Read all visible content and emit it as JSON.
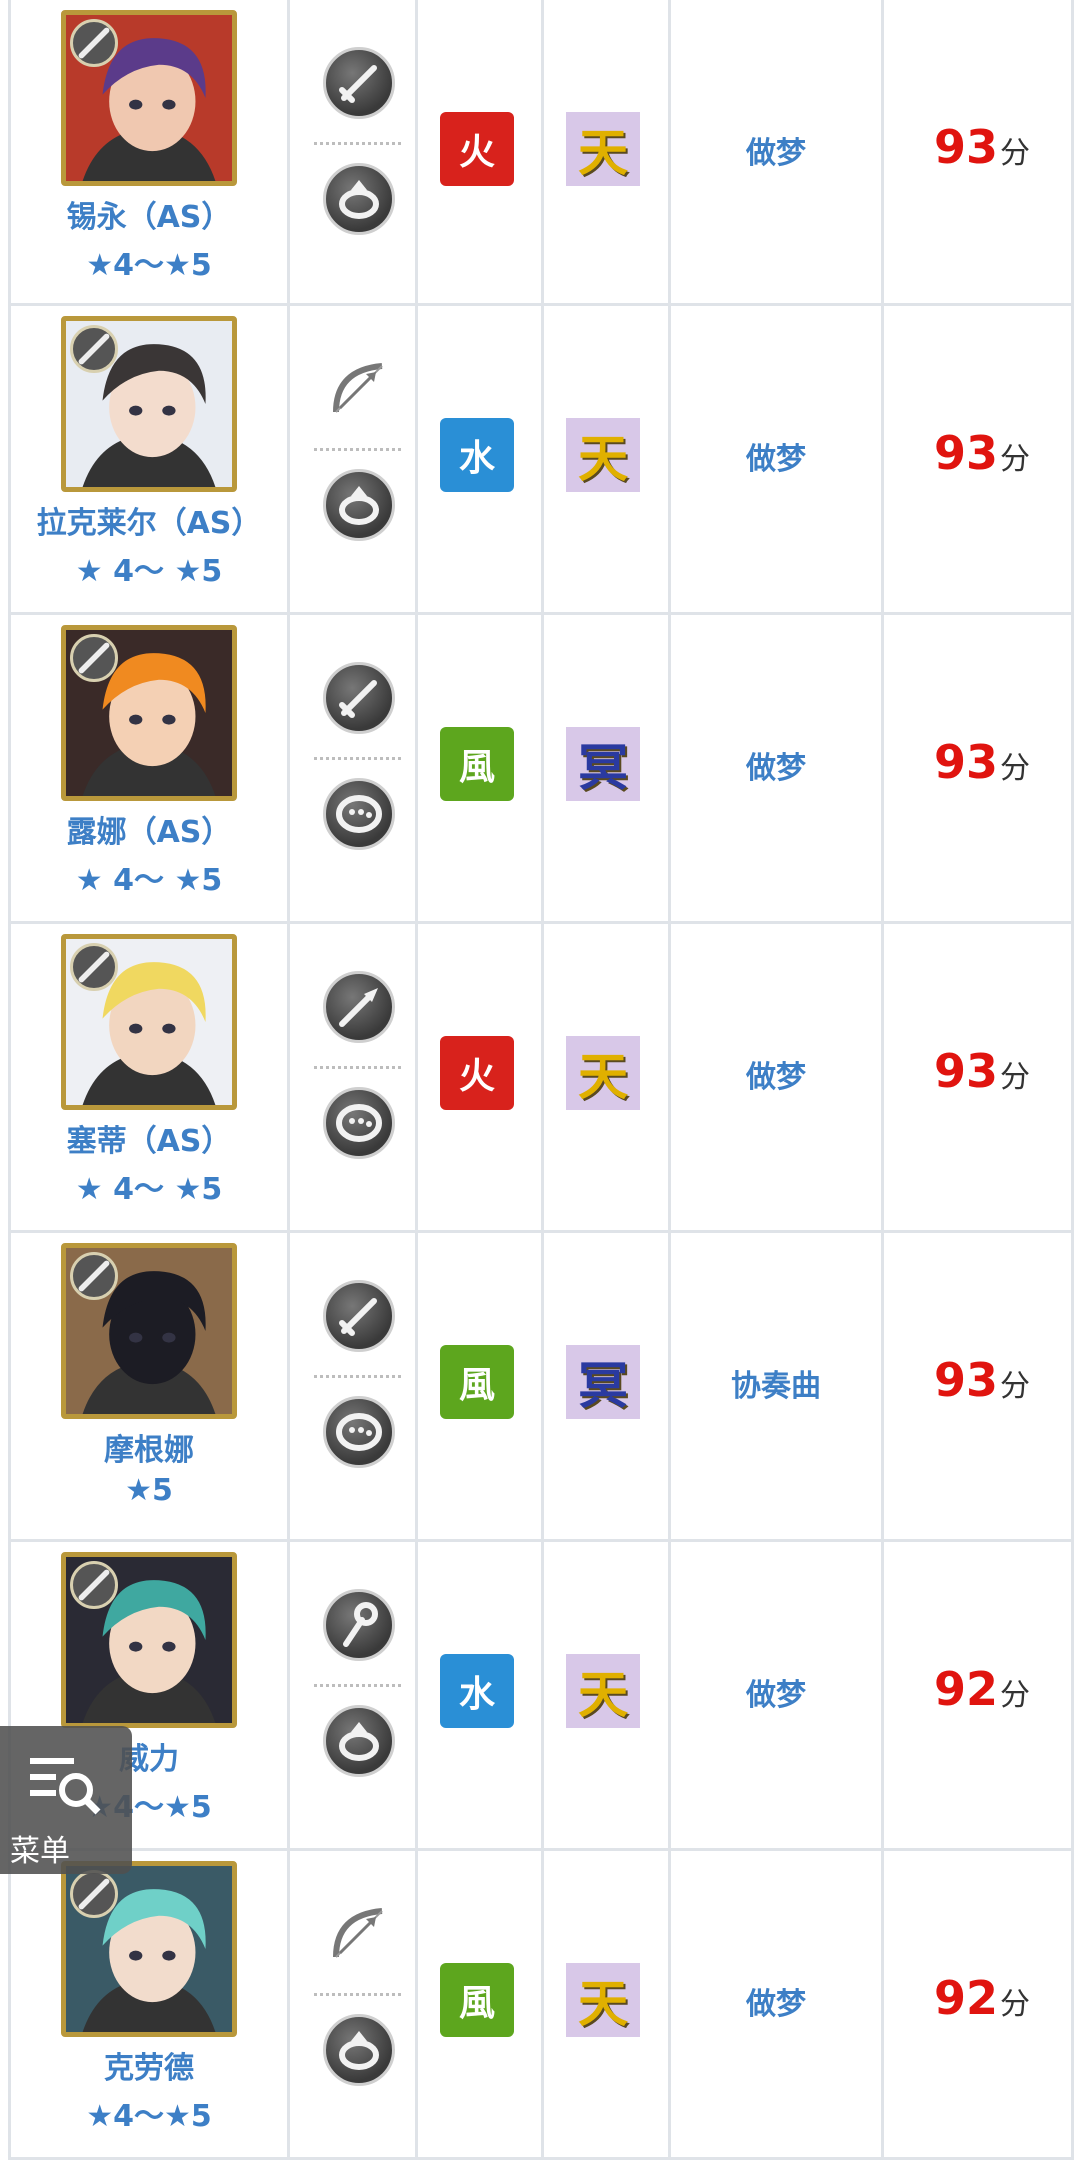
{
  "colors": {
    "fire": "#d8221c",
    "water": "#2a8fd6",
    "wind": "#5da61e",
    "name_blue": "#3d7fc6",
    "score_red": "#e0140f"
  },
  "rows": [
    {
      "name": "锡永（AS）",
      "stars": "★4～★5",
      "weapon_icon": "sword-icon",
      "accessory_icon": "ring-icon",
      "attr": "火",
      "attr_color": "#d8221c",
      "class": "天",
      "class_color": "#e0b000",
      "type": "做梦",
      "score": "93",
      "unit": "分",
      "skin": "#f0c8b0",
      "hair": "#5b3b8a",
      "bg": "#b83a2a"
    },
    {
      "name": "拉克莱尔（AS）",
      "stars": "★ 4～ ★5",
      "weapon_icon": "bow-icon",
      "accessory_icon": "ring-icon",
      "attr": "水",
      "attr_color": "#2a8fd6",
      "class": "天",
      "class_color": "#e0b000",
      "type": "做梦",
      "score": "93",
      "unit": "分",
      "skin": "#f3dccd",
      "hair": "#3a3636",
      "bg": "#e8ecf2"
    },
    {
      "name": "露娜（AS）",
      "stars": "★ 4～ ★5",
      "weapon_icon": "sword-icon",
      "accessory_icon": "bracelet-icon",
      "attr": "風",
      "attr_color": "#5da61e",
      "class": "冥",
      "class_color": "#2a3aa0",
      "type": "做梦",
      "score": "93",
      "unit": "分",
      "skin": "#f4d0b4",
      "hair": "#f08a20",
      "bg": "#3a2a28"
    },
    {
      "name": "塞蒂（AS）",
      "stars": "★ 4～ ★5",
      "weapon_icon": "spear-icon",
      "accessory_icon": "bracelet-icon",
      "attr": "火",
      "attr_color": "#d8221c",
      "class": "天",
      "class_color": "#e0b000",
      "type": "做梦",
      "score": "93",
      "unit": "分",
      "skin": "#f2d6c0",
      "hair": "#f0d860",
      "bg": "#eef0f4"
    },
    {
      "name": "摩根娜",
      "stars": "★5",
      "weapon_icon": "sword-icon",
      "accessory_icon": "bracelet-icon",
      "attr": "風",
      "attr_color": "#5da61e",
      "class": "冥",
      "class_color": "#2a3aa0",
      "type": "协奏曲",
      "score": "93",
      "unit": "分",
      "skin": "#1c1c24",
      "hair": "#1c1c24",
      "bg": "#8a6a4a"
    },
    {
      "name": "威力",
      "stars": "★4～★5",
      "weapon_icon": "staff-icon",
      "accessory_icon": "ring-icon",
      "attr": "水",
      "attr_color": "#2a8fd6",
      "class": "天",
      "class_color": "#e0b000",
      "type": "做梦",
      "score": "92",
      "unit": "分",
      "skin": "#f2d8c4",
      "hair": "#3fa8a0",
      "bg": "#2a2a34"
    },
    {
      "name": "克劳德",
      "stars": "★4～★5",
      "weapon_icon": "bow-icon",
      "accessory_icon": "ring-icon",
      "attr": "風",
      "attr_color": "#5da61e",
      "class": "天",
      "class_color": "#e0b000",
      "type": "做梦",
      "score": "92",
      "unit": "分",
      "skin": "#f2dccc",
      "hair": "#6fd0c8",
      "bg": "#3a5a66"
    }
  ],
  "menu": {
    "label": "菜单",
    "icon": "menu-search-icon"
  }
}
